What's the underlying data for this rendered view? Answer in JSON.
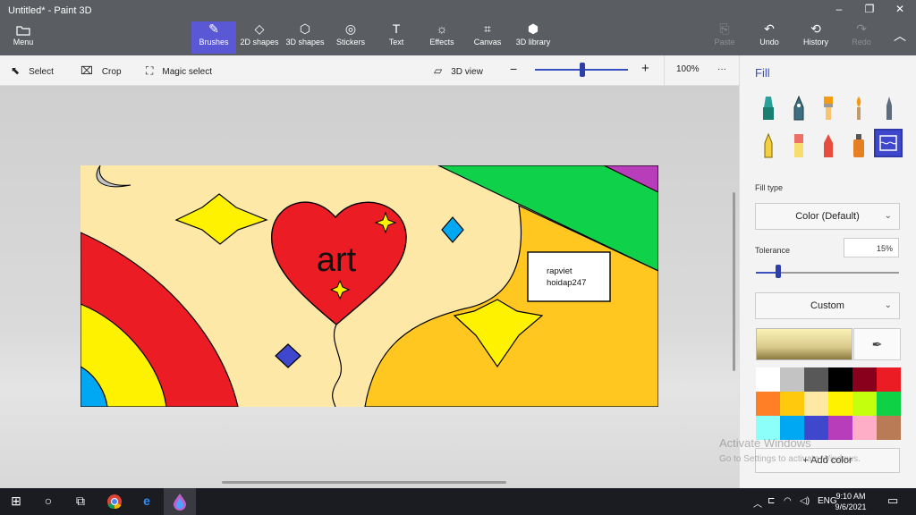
{
  "window": {
    "title": "Untitled* - Paint 3D",
    "minimize": "–",
    "maximize": "❐",
    "close": "✕"
  },
  "menu": {
    "label": "Menu"
  },
  "tools": [
    {
      "label": "Brushes",
      "active": true
    },
    {
      "label": "2D shapes"
    },
    {
      "label": "3D shapes"
    },
    {
      "label": "Stickers"
    },
    {
      "label": "Text"
    },
    {
      "label": "Effects"
    },
    {
      "label": "Canvas"
    },
    {
      "label": "3D library"
    }
  ],
  "edit_actions": {
    "paste": "Paste",
    "undo": "Undo",
    "history": "History",
    "redo": "Redo"
  },
  "toolbar2": {
    "select": "Select",
    "crop": "Crop",
    "magic_select": "Magic select",
    "view3d": "3D view",
    "zoom": "100%",
    "more": "···"
  },
  "canvas": {
    "heart_text": "art",
    "note_line1": "rapviet",
    "note_line2": "hoidap247"
  },
  "panel": {
    "title": "Fill",
    "fill_type_label": "Fill type",
    "fill_type_value": "Color (Default)",
    "tolerance_label": "Tolerance",
    "tolerance_value": "15%",
    "tolerance_level": 0.15,
    "preset_value": "Custom",
    "add_color": "Add color",
    "palette": [
      "#ffffff",
      "#c3c3c3",
      "#585858",
      "#000000",
      "#88001b",
      "#ec1c24",
      "#ff7f27",
      "#ffc90e",
      "#fde8a4",
      "#fff200",
      "#c4ff0e",
      "#0ed145",
      "#8cfffb",
      "#00a8f3",
      "#3f48cc",
      "#b83dba",
      "#ffaec8",
      "#b97a56"
    ]
  },
  "watermark": {
    "line1": "Activate Windows",
    "line2": "Go to Settings to activate Windows."
  },
  "taskbar": {
    "lang": "ENG",
    "time": "9:10 AM",
    "date": "9/6/2021"
  }
}
